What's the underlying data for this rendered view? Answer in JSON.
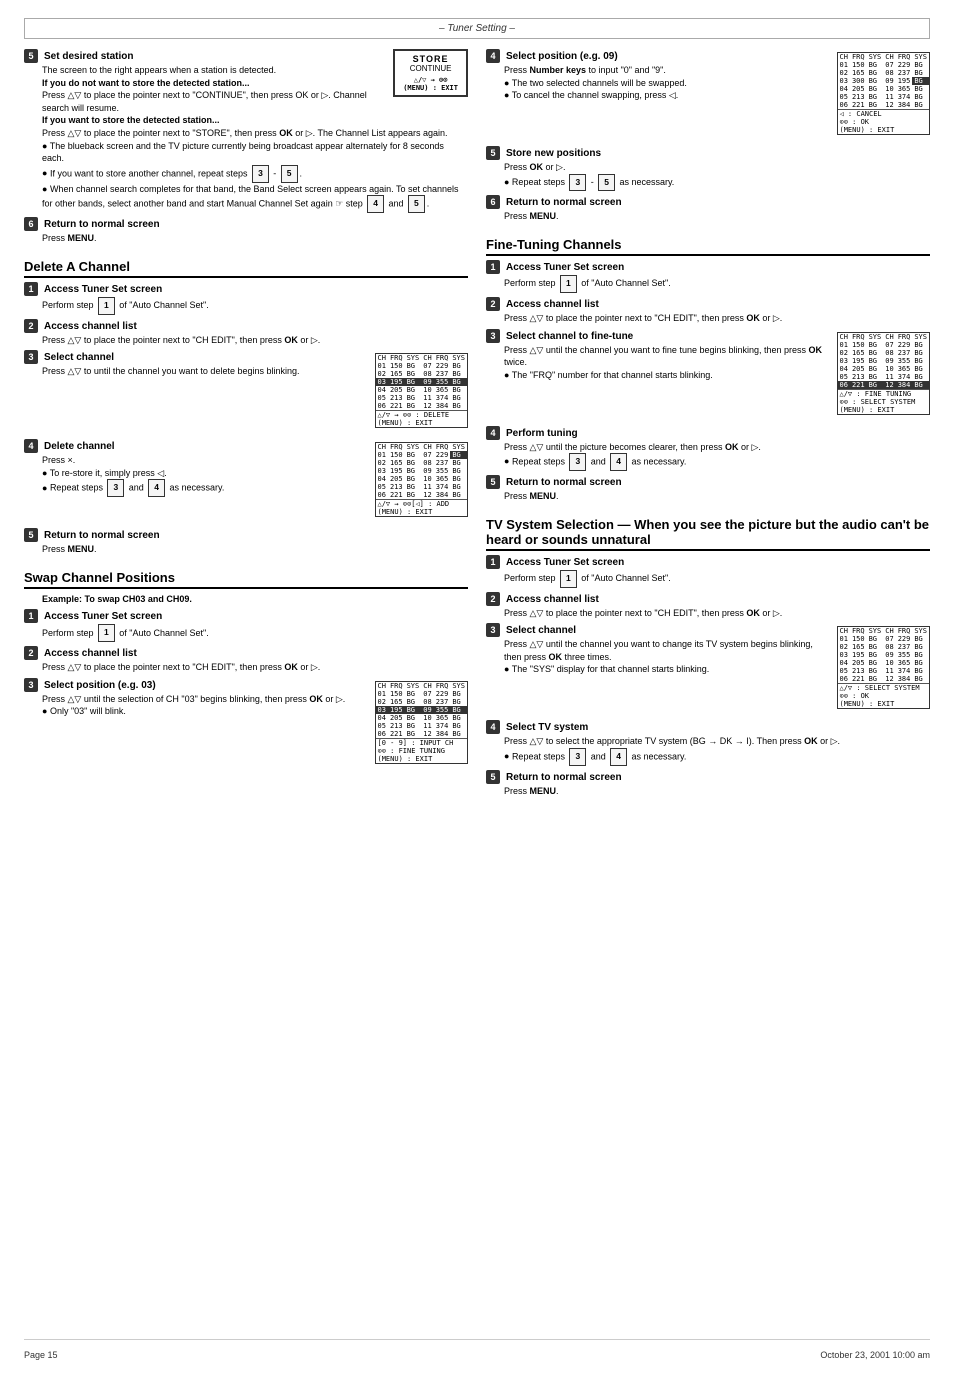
{
  "header": {
    "title": "– Tuner Setting –"
  },
  "footer": {
    "page": "Page 15",
    "date": "October 23, 2001 10:00 am"
  },
  "left_col": {
    "tuner_setting": {
      "step5": {
        "title": "Set desired station",
        "body": "The screen to the right appears when a station is detected.",
        "if_not_store": {
          "label": "If you do not want to store the detected station...",
          "text": "Press △▽ to place the pointer next to \"CONTINUE\", then press OK or ▷. Channel search will resume."
        },
        "if_want_store": {
          "label": "If you want to store the detected station...",
          "text": "Press △▽ to place the pointer next to \"STORE\", then press OK or ▷. The Channel List appears again.",
          "bullets": [
            "The blueback screen and the TV picture currently being broadcast appear alternately for 8 seconds each.",
            "If you want to store another channel, repeat steps 3 - 5.",
            "When channel search completes for that band, the Band Select screen appears again. To set channels for other bands, select another band and start Manual Channel Set again ☞ step 4 and 5."
          ]
        }
      },
      "step6": {
        "title": "Return to normal screen",
        "text": "Press MENU."
      }
    },
    "delete_channel": {
      "title": "Delete A Channel",
      "step1": {
        "title": "Access Tuner Set screen",
        "text": "Perform step 1 of \"Auto Channel Set\"."
      },
      "step2": {
        "title": "Access channel list",
        "text": "Press △▽ to place the pointer next to \"CH EDIT\", then press OK or ▷."
      },
      "step3": {
        "title": "Select channel",
        "text": "Press △▽ to until the channel you want to delete begins blinking."
      },
      "step4": {
        "title": "Delete channel",
        "text": "Press ×.",
        "bullets": [
          "To re-store it, simply press ◁.",
          "Repeat steps 3 and 4 as necessary."
        ]
      },
      "step5": {
        "title": "Return to normal screen",
        "text": "Press MENU."
      }
    },
    "swap_channel": {
      "title": "Swap Channel Positions",
      "example": "Example: To swap CH03 and CH09.",
      "step1": {
        "title": "Access Tuner Set screen",
        "text": "Perform step 1 of \"Auto Channel Set\"."
      },
      "step2": {
        "title": "Access channel list",
        "text": "Press △▽ to place the pointer next to \"CH EDIT\", then press OK or ▷."
      },
      "step3": {
        "title": "Select position (e.g. 03)",
        "text": "Press △▽ until the selection of CH \"03\" begins blinking, then press OK or ▷.",
        "bullets": [
          "Only \"03\" will blink."
        ]
      }
    }
  },
  "right_col": {
    "select_position": {
      "title": "Select position (e.g. 09)",
      "step_num": "4",
      "text": "Press Number keys to input \"0\" and \"9\".",
      "bullets": [
        "The two selected channels will be swapped.",
        "To cancel the channel swapping, press ◁."
      ]
    },
    "store_new": {
      "title": "Store new positions",
      "step_num": "5",
      "text": "Press OK or ▷.",
      "extra": "Repeat steps 3 - 5 as necessary."
    },
    "return_normal1": {
      "title": "Return to normal screen",
      "step_num": "6",
      "text": "Press MENU."
    },
    "fine_tuning": {
      "title": "Fine-Tuning Channels",
      "step1": {
        "title": "Access Tuner Set screen",
        "text": "Perform step 1 of \"Auto Channel Set\"."
      },
      "step2": {
        "title": "Access channel list",
        "text": "Press △▽ to place the pointer next to \"CH EDIT\", then press OK or ▷."
      },
      "step3": {
        "title": "Select channel to fine-tune",
        "text": "Press △▽ until the channel you want to fine tune begins blinking, then press OK twice.",
        "bullets": [
          "The \"FRQ\" number for that channel starts blinking."
        ]
      },
      "step4": {
        "title": "Perform tuning",
        "text": "Press △▽ until the picture becomes clearer, then press OK or ▷.",
        "bullets": [
          "Repeat steps 3 and 4 as necessary."
        ]
      },
      "step5": {
        "title": "Return to normal screen",
        "text": "Press MENU."
      }
    },
    "tv_system": {
      "title": "TV System Selection — When you see the picture but the audio can't be heard or sounds unnatural",
      "step1": {
        "title": "Access Tuner Set screen",
        "text": "Perform step 1 of \"Auto Channel Set\"."
      },
      "step2": {
        "title": "Access channel list",
        "text": "Press △▽ to place the pointer next to \"CH EDIT\", then press OK or ▷."
      },
      "step3": {
        "title": "Select channel",
        "text": "Press △▽ until the channel you want to change its TV system begins blinking, then press OK three times.",
        "bullets": [
          "The \"SYS\" display for that channel starts blinking."
        ]
      },
      "step4": {
        "title": "Select TV system",
        "text": "Press △▽ to select the appropriate TV system (BG → DK → I). Then press OK or ▷.",
        "bullets": [
          "Repeat steps 3 and 4 as necessary."
        ]
      },
      "step5": {
        "title": "Return to normal screen",
        "text": "Press MENU."
      }
    }
  }
}
